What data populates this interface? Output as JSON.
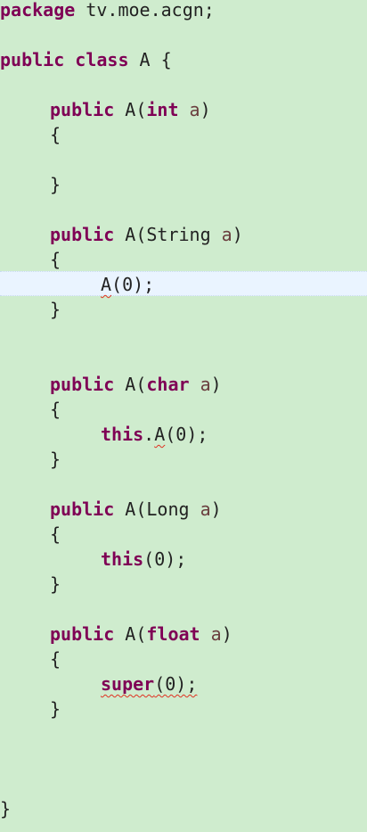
{
  "colors": {
    "editor_background": "#cfecce",
    "current_line": "#eaf4ff",
    "keyword": "#7f0055",
    "parameter": "#6a3e3e",
    "text": "#222222",
    "error_underline": "#e03020"
  },
  "code": {
    "package_kw": "package",
    "package_name": " tv.moe.acgn;",
    "class_decl": {
      "kw": "public class",
      "rest": " A {"
    },
    "ctor_int": {
      "kw_public": "public",
      "name": " A(",
      "type": "int",
      "param": " a",
      "close": ")",
      "open_brace": "{",
      "close_brace": "}"
    },
    "ctor_string": {
      "kw_public": "public",
      "sig": " A(String",
      "param": " a",
      "close": ")",
      "open_brace": "{",
      "call_name": "A",
      "call_args": "(0);",
      "close_brace": "}"
    },
    "ctor_char": {
      "kw_public": "public",
      "name": " A(",
      "type": "char",
      "param": " a",
      "close": ")",
      "open_brace": "{",
      "this_kw": "this",
      "dot": ".",
      "call_name": "A",
      "call_args": "(0);",
      "close_brace": "}"
    },
    "ctor_long": {
      "kw_public": "public",
      "sig": " A(Long",
      "param": " a",
      "close": ")",
      "open_brace": "{",
      "this_kw": "this",
      "call_args": "(0);",
      "close_brace": "}"
    },
    "ctor_float": {
      "kw_public": "public",
      "name": " A(",
      "type": "float",
      "param": " a",
      "close": ")",
      "open_brace": "{",
      "super_kw": "super",
      "call_args": "(0);",
      "close_brace": "}"
    },
    "class_close": "}"
  }
}
